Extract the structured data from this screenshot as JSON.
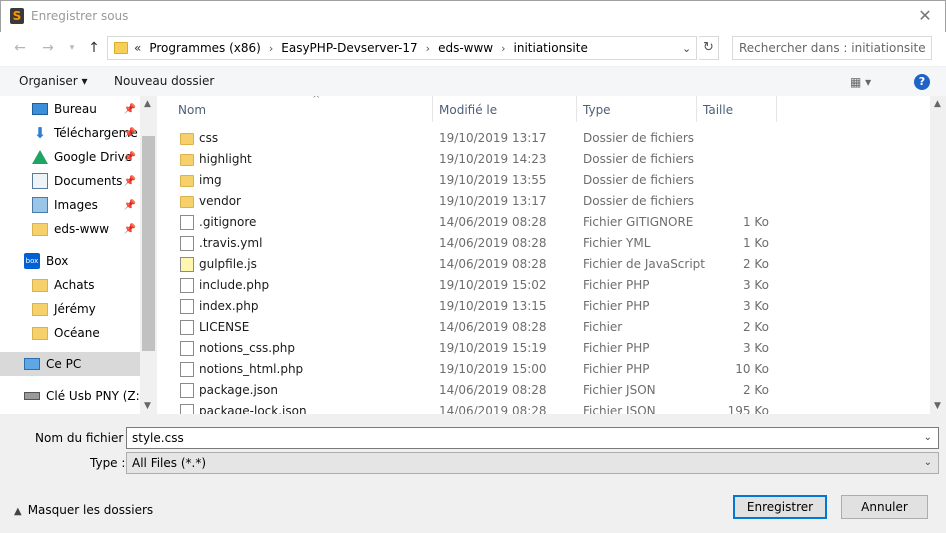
{
  "window": {
    "title": "Enregistrer sous",
    "close": "✕"
  },
  "address": {
    "prefix": "«",
    "crumbs": [
      "Programmes (x86)",
      "EasyPHP-Devserver-17",
      "eds-www",
      "initiationsite"
    ],
    "search_placeholder": "Rechercher dans : initiationsite"
  },
  "toolbar": {
    "organize": "Organiser ▾",
    "new_folder": "Nouveau dossier",
    "view": "▦ ▾",
    "help": "?"
  },
  "sidebar": {
    "items": [
      {
        "label": "Bureau",
        "icon": "desktop-icon",
        "pinned": true
      },
      {
        "label": "Téléchargeme",
        "icon": "download-icon",
        "pinned": true
      },
      {
        "label": "Google Drive",
        "icon": "google-drive-icon",
        "pinned": true
      },
      {
        "label": "Documents",
        "icon": "documents-icon",
        "pinned": true
      },
      {
        "label": "Images",
        "icon": "images-icon",
        "pinned": true
      },
      {
        "label": "eds-www",
        "icon": "folder-icon",
        "pinned": true
      },
      {
        "label": "Box",
        "icon": "box-icon",
        "pinned": false
      },
      {
        "label": "Achats",
        "icon": "folder-icon",
        "pinned": false
      },
      {
        "label": "Jérémy",
        "icon": "folder-icon",
        "pinned": false
      },
      {
        "label": "Océane",
        "icon": "folder-icon",
        "pinned": false
      },
      {
        "label": "Ce PC",
        "icon": "computer-icon",
        "pinned": false,
        "selected": true
      },
      {
        "label": "Clé Usb PNY (Z:)",
        "icon": "usb-drive-icon",
        "pinned": false
      }
    ]
  },
  "columns": [
    "Nom",
    "Modifié le",
    "Type",
    "Taille"
  ],
  "files": [
    {
      "name": "css",
      "date": "19/10/2019 13:17",
      "type": "Dossier de fichiers",
      "size": "",
      "icon": "folder"
    },
    {
      "name": "highlight",
      "date": "19/10/2019 14:23",
      "type": "Dossier de fichiers",
      "size": "",
      "icon": "folder"
    },
    {
      "name": "img",
      "date": "19/10/2019 13:55",
      "type": "Dossier de fichiers",
      "size": "",
      "icon": "folder"
    },
    {
      "name": "vendor",
      "date": "19/10/2019 13:17",
      "type": "Dossier de fichiers",
      "size": "",
      "icon": "folder"
    },
    {
      "name": ".gitignore",
      "date": "14/06/2019 08:28",
      "type": "Fichier GITIGNORE",
      "size": "1 Ko",
      "icon": "file"
    },
    {
      "name": ".travis.yml",
      "date": "14/06/2019 08:28",
      "type": "Fichier YML",
      "size": "1 Ko",
      "icon": "file"
    },
    {
      "name": "gulpfile.js",
      "date": "14/06/2019 08:28",
      "type": "Fichier de JavaScript",
      "size": "2 Ko",
      "icon": "js"
    },
    {
      "name": "include.php",
      "date": "19/10/2019 15:02",
      "type": "Fichier PHP",
      "size": "3 Ko",
      "icon": "file"
    },
    {
      "name": "index.php",
      "date": "19/10/2019 13:15",
      "type": "Fichier PHP",
      "size": "3 Ko",
      "icon": "file"
    },
    {
      "name": "LICENSE",
      "date": "14/06/2019 08:28",
      "type": "Fichier",
      "size": "2 Ko",
      "icon": "file"
    },
    {
      "name": "notions_css.php",
      "date": "19/10/2019 15:19",
      "type": "Fichier PHP",
      "size": "3 Ko",
      "icon": "file"
    },
    {
      "name": "notions_html.php",
      "date": "19/10/2019 15:00",
      "type": "Fichier PHP",
      "size": "10 Ko",
      "icon": "file"
    },
    {
      "name": "package.json",
      "date": "14/06/2019 08:28",
      "type": "Fichier JSON",
      "size": "2 Ko",
      "icon": "file"
    },
    {
      "name": "package-lock.json",
      "date": "14/06/2019 08:28",
      "type": "Fichier JSON",
      "size": "195 Ko",
      "icon": "file"
    }
  ],
  "form": {
    "filename_label": "Nom du fichier :",
    "filename_value": "style.css",
    "filetype_label": "Type :",
    "filetype_value": "All Files (*.*)",
    "hide_folders": "Masquer les dossiers",
    "save": "Enregistrer",
    "cancel": "Annuler"
  }
}
